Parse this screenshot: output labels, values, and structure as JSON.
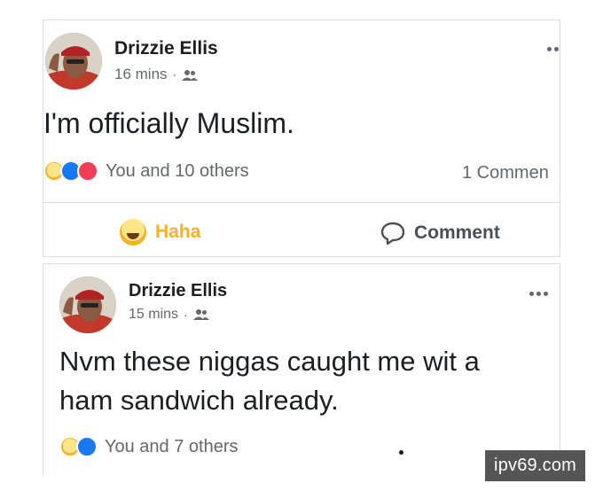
{
  "posts": [
    {
      "author": "Drizzie Ellis",
      "time": "16 mins",
      "privacy_icon": "friends-icon",
      "text": "I'm officially Muslim.",
      "reactions_text": "You and 10 others",
      "reaction_icons": [
        "haha",
        "like",
        "love"
      ],
      "comments_count": "1 Commen",
      "actions": {
        "reaction_label": "Haha",
        "comment_label": "Comment"
      }
    },
    {
      "author": "Drizzie Ellis",
      "time": "15 mins",
      "privacy_icon": "friends-icon",
      "text_line1": "Nvm these niggas caught me wit a",
      "text_line2": "ham sandwich already.",
      "reactions_text": "You and 7 others",
      "reaction_icons": [
        "haha",
        "like"
      ]
    }
  ],
  "watermark": "ipv69.com",
  "colors": {
    "haha_yellow": "#f7b125",
    "like_blue": "#1877f2",
    "love_red": "#f33e58",
    "meta_gray": "#65676b",
    "border": "#dadde1"
  }
}
